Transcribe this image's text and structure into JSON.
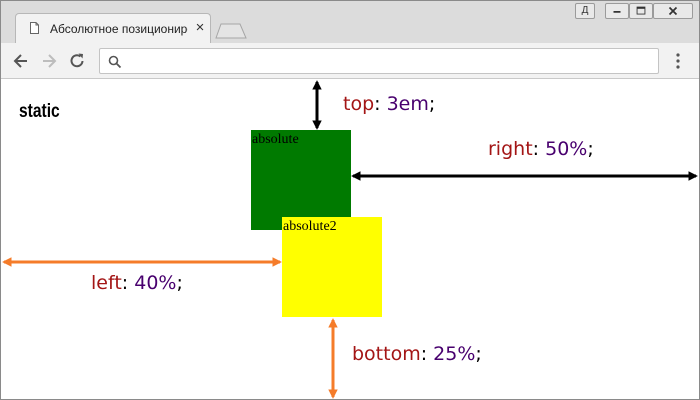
{
  "browser": {
    "tab_title": "Абсолютное позиционирование",
    "address_value": "",
    "window_button_labels": [
      "Д"
    ]
  },
  "page": {
    "static_label": "static",
    "green_box_label": "absolute",
    "yellow_box_label": "absolute2",
    "annotations": {
      "top": {
        "prop": "top",
        "sep": ": ",
        "value": "3em",
        "end": ";"
      },
      "right": {
        "prop": "right",
        "sep": ": ",
        "value": "50%",
        "end": ";"
      },
      "left": {
        "prop": "left",
        "sep": ": ",
        "value": "40%",
        "end": ";"
      },
      "bottom": {
        "prop": "bottom",
        "sep": ": ",
        "value": "25%",
        "end": ";"
      }
    }
  },
  "colors": {
    "green_box": "#007a00",
    "yellow_box": "#ffff00",
    "black_arrow": "#000000",
    "orange_arrow": "#f57c2a",
    "property_color": "#a31515",
    "value_color": "#48006e"
  },
  "icons": [
    "page-icon",
    "close-icon",
    "new-tab-icon",
    "user-icon",
    "minimize-icon",
    "maximize-icon",
    "window-close-icon",
    "back-icon",
    "forward-icon",
    "reload-icon",
    "search-icon",
    "menu-icon"
  ]
}
